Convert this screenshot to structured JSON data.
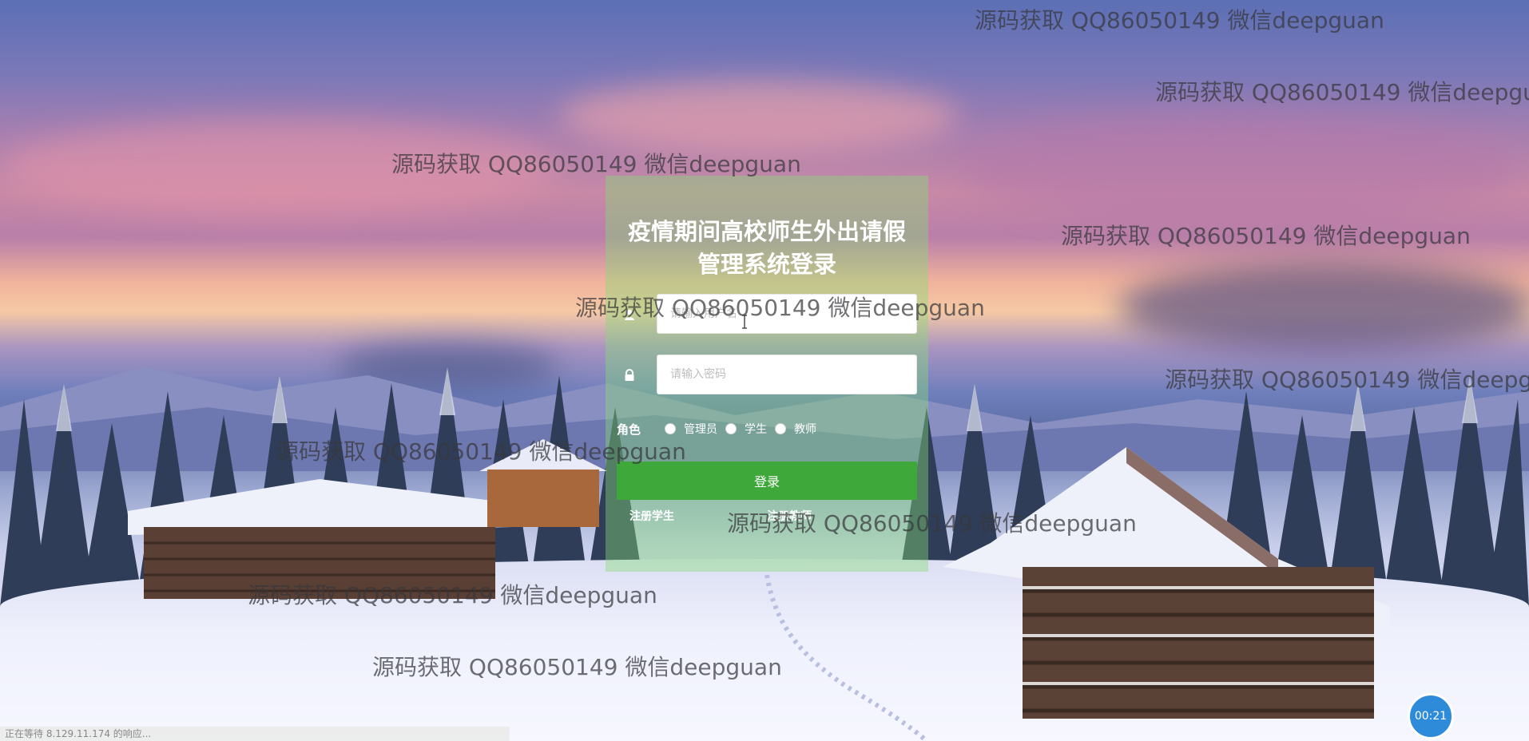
{
  "login": {
    "title": "疫情期间高校师生外出请假管理系统登录",
    "username_placeholder": "请输入用户名",
    "password_placeholder": "请输入密码",
    "role_label": "角色",
    "roles": [
      "管理员",
      "学生",
      "教师"
    ],
    "login_button": "登录",
    "register_student": "注册学生",
    "register_teacher": "注册教师"
  },
  "watermark_text": "源码获取 QQ86050149 微信deepguan",
  "timer": "00:21",
  "status_text": "正在等待 8.129.11.174 的响应...",
  "colors": {
    "card_overlay": "#86dc78",
    "button": "#3fa83a",
    "timer": "#2e8bd9"
  },
  "icons": {
    "username": "user-icon",
    "password": "lock-icon"
  }
}
